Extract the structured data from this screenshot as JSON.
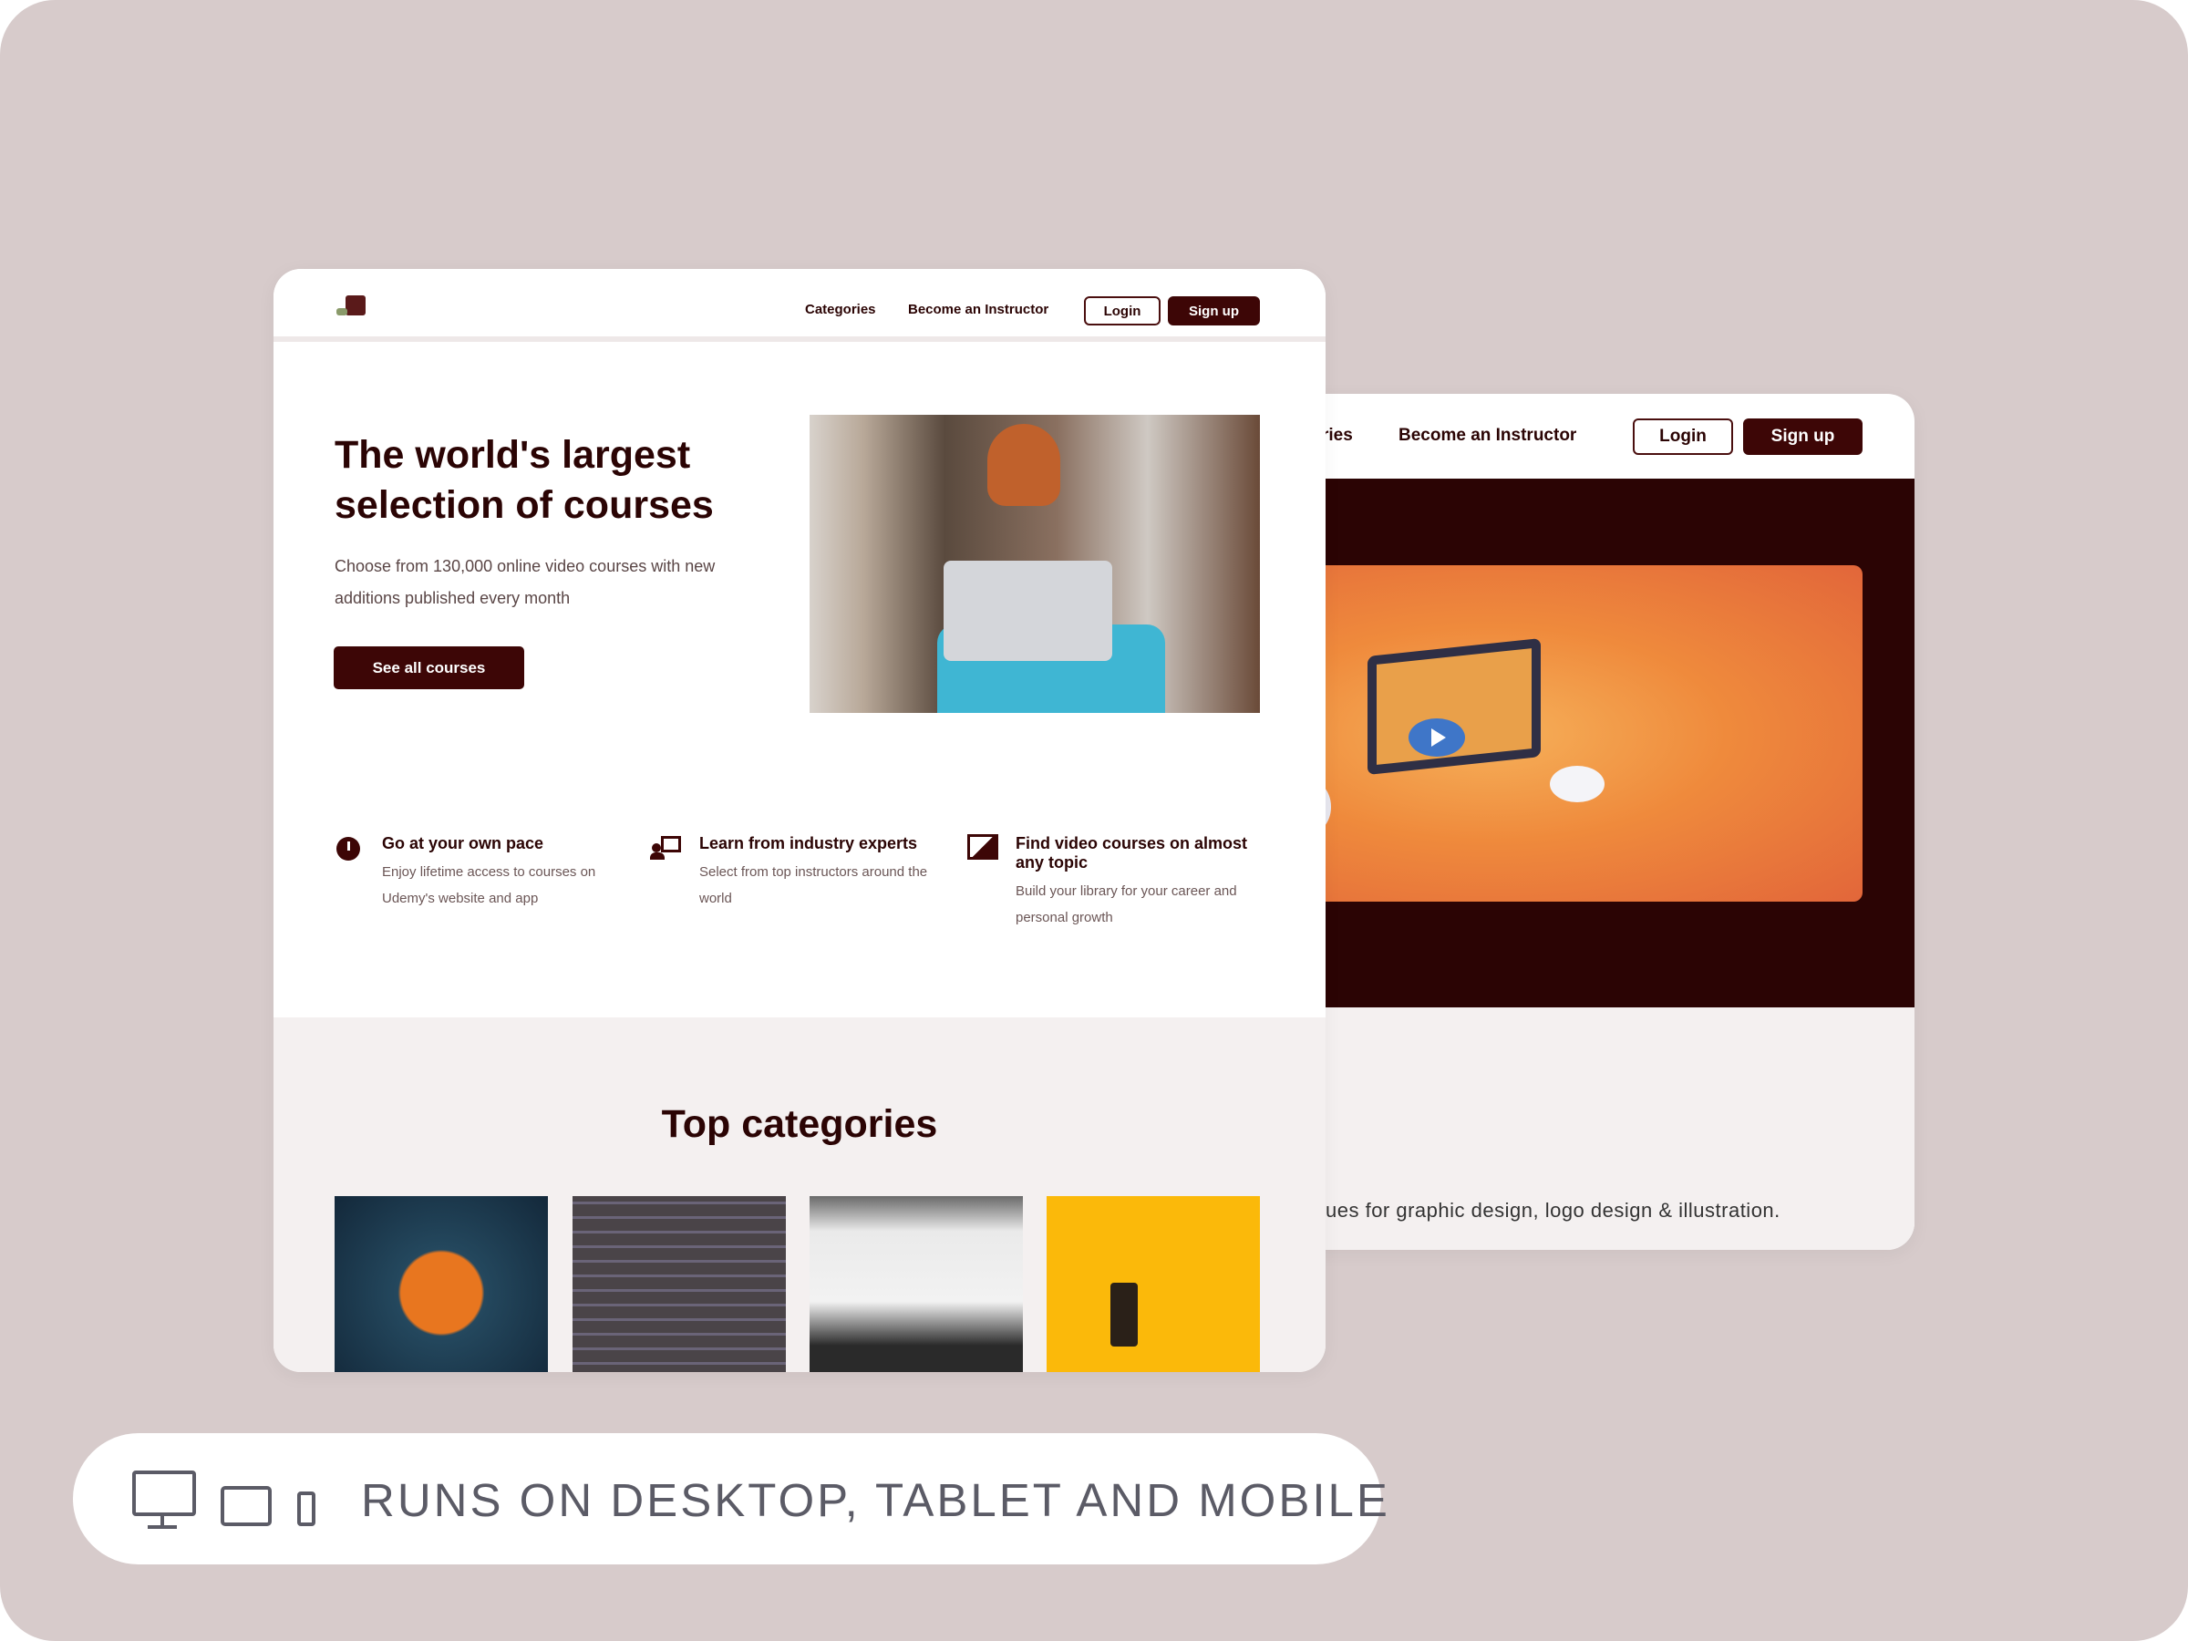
{
  "front": {
    "nav": {
      "logo": "logo",
      "categories": "Categories",
      "instructor": "Become an Instructor",
      "login": "Login",
      "signup": "Sign up"
    },
    "hero": {
      "title_line1": "The world's largest",
      "title_line2": "selection of courses",
      "subtitle": "Choose from 130,000 online video courses with new additions published every month",
      "cta": "See all courses"
    },
    "features": [
      {
        "icon": "clock-icon",
        "title": "Go at your own pace",
        "desc": "Enjoy lifetime access to courses on Udemy's website and app"
      },
      {
        "icon": "instructor-icon",
        "title": "Learn from industry experts",
        "desc": "Select from top instructors around the world"
      },
      {
        "icon": "video-library-icon",
        "title": "Find video courses on almost any topic",
        "desc": "Build your library for your career and personal growth"
      }
    ],
    "categories_title": "Top categories",
    "category_tiles": [
      "design",
      "development",
      "data-analytics",
      "photography"
    ]
  },
  "back": {
    "nav": {
      "categories_partial": "ries",
      "instructor": "Become an Instructor",
      "login": "Login",
      "signup": "Sign up"
    },
    "video": {
      "play_icon": "play-icon"
    },
    "desc_partial": "ues for graphic design, logo design & illustration."
  },
  "banner": {
    "text": "RUNS ON DESKTOP, TABLET AND MOBILE",
    "icons": [
      "desktop-icon",
      "tablet-icon",
      "mobile-icon"
    ]
  },
  "colors": {
    "brand": "#3d0606",
    "background": "#d7cbcb",
    "section": "#f4f0f0",
    "video_bg": "#2b0404",
    "video_accent": "#ef8a3c",
    "play": "#3f76c8"
  }
}
